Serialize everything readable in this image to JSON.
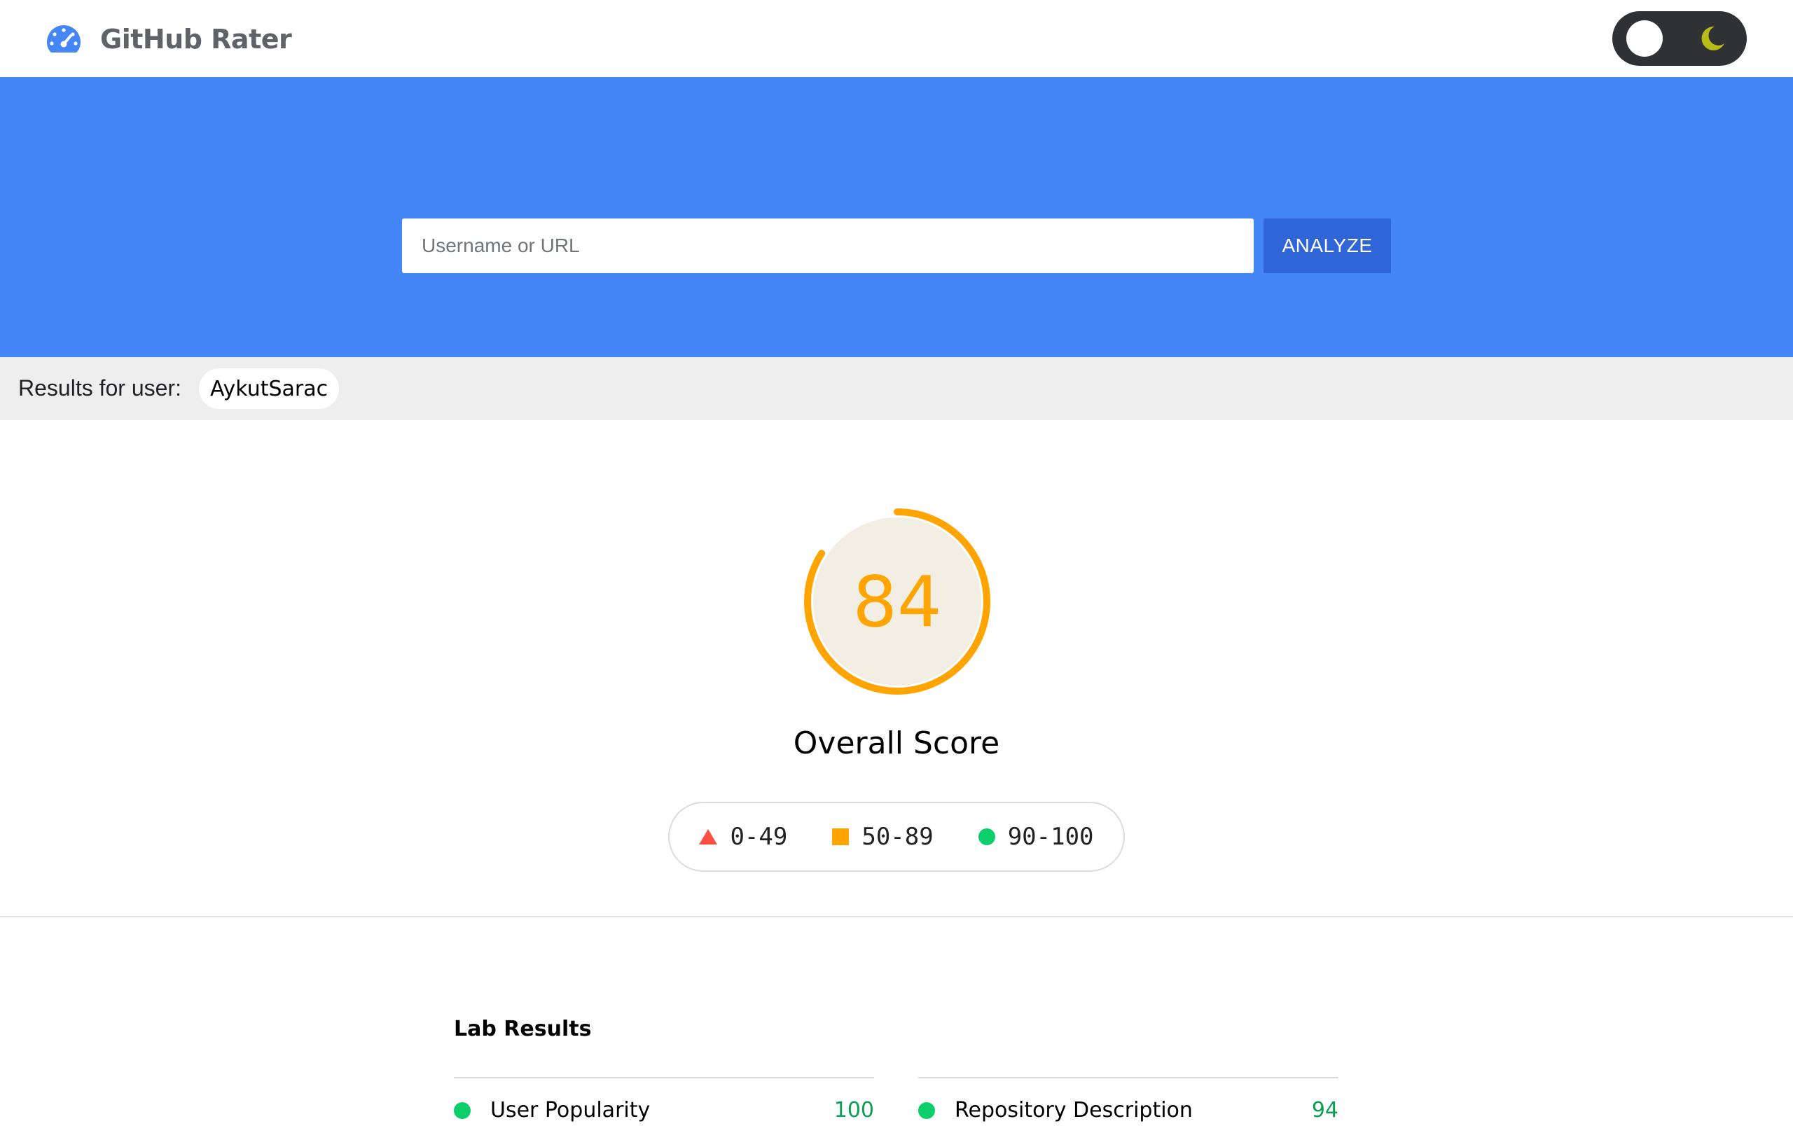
{
  "header": {
    "app_title": "GitHub Rater",
    "logo_icon": "speedometer-icon",
    "theme_toggle": {
      "state": "light",
      "icon": "moon-icon"
    }
  },
  "search": {
    "placeholder": "Username or URL",
    "value": "",
    "button_label": "ANALYZE"
  },
  "results": {
    "label": "Results for user:",
    "username": "AykutSarac"
  },
  "overall": {
    "score": 84,
    "score_text": "84",
    "label": "Overall Score",
    "color": "#ffa400"
  },
  "legend": [
    {
      "range": "0-49",
      "shape": "triangle",
      "color": "#ff4e42"
    },
    {
      "range": "50-89",
      "shape": "square",
      "color": "#ffa400"
    },
    {
      "range": "90-100",
      "shape": "circle",
      "color": "#0cce6b"
    }
  ],
  "lab": {
    "title": "Lab Results",
    "metrics": [
      {
        "label": "User Popularity",
        "score": "100",
        "status_color": "#0cce6b"
      },
      {
        "label": "Repository Description",
        "score": "94",
        "status_color": "#0cce6b"
      }
    ]
  },
  "colors": {
    "brand_blue": "#4486f5",
    "button_blue": "#2f65d6",
    "results_bar": "#eeeeee"
  }
}
